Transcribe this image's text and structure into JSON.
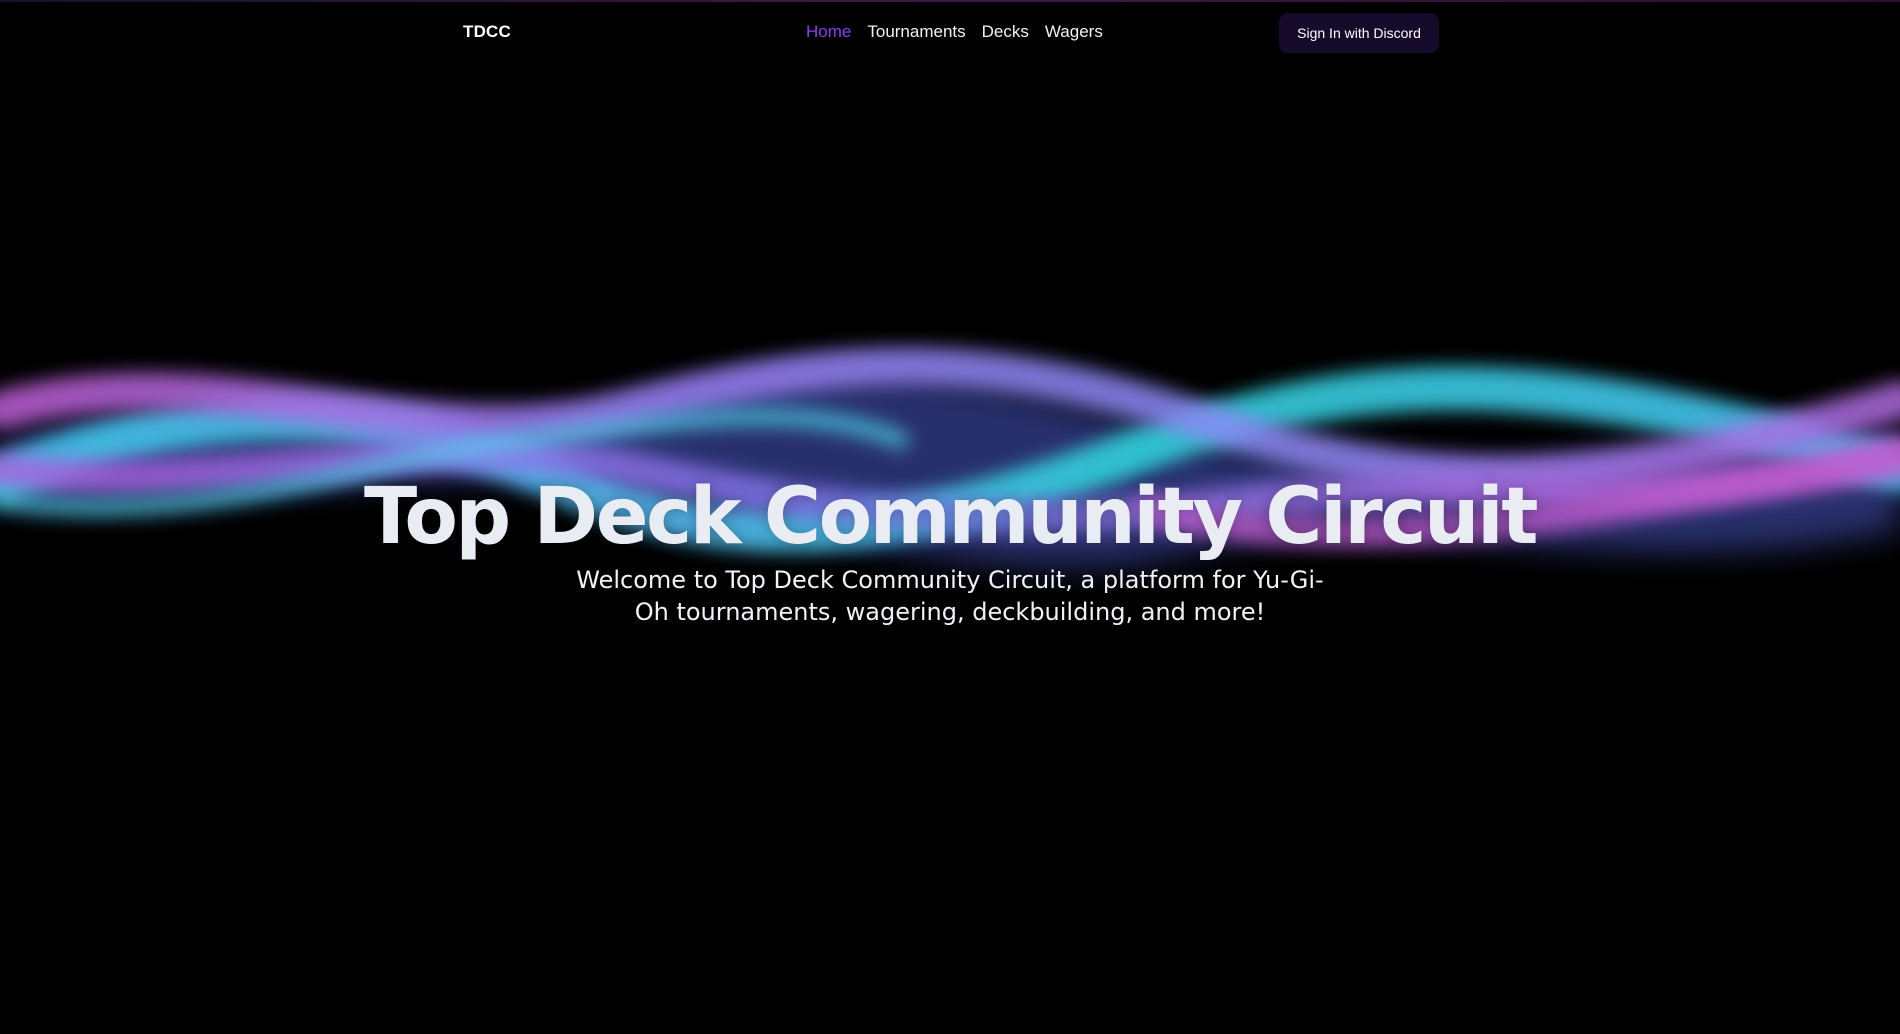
{
  "nav": {
    "brand": "TDCC",
    "links": [
      {
        "label": "Home",
        "active": true
      },
      {
        "label": "Tournaments",
        "active": false
      },
      {
        "label": "Decks",
        "active": false
      },
      {
        "label": "Wagers",
        "active": false
      }
    ],
    "signin_label": "Sign In with Discord"
  },
  "hero": {
    "title": "Top Deck Community Circuit",
    "subtitle": "Welcome to Top Deck Community Circuit, a platform for Yu-Gi-Oh tournaments, wagering, deckbuilding, and more!"
  },
  "colors": {
    "background": "#000000",
    "accent": "#8b3cf0",
    "button_bg": "#160b2a",
    "aurora_cyan": "#3fc6e8",
    "aurora_purple": "#9b7bf0",
    "aurora_magenta": "#c05fd8"
  }
}
